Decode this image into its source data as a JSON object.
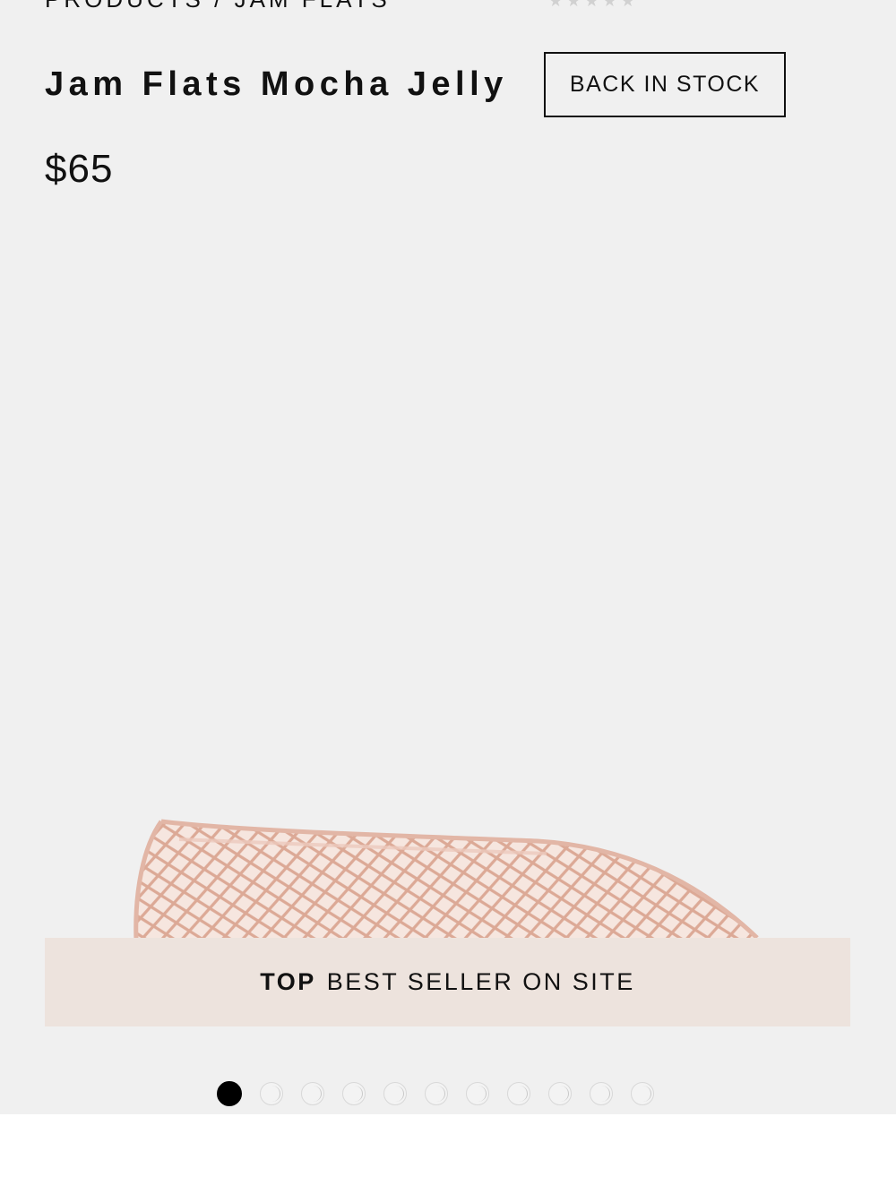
{
  "breadcrumb": "PRODUCTS / JAM FLATS",
  "product": {
    "title": "Jam Flats Mocha Jelly",
    "stock_badge": "BACK IN STOCK",
    "price": "$65"
  },
  "banner": {
    "strong": "TOP",
    "text": "BEST SELLER ON SITE"
  },
  "carousel": {
    "total_slides": 11,
    "active_index": 0
  },
  "colors": {
    "background": "#f0f0f0",
    "banner": "#ede3dd",
    "product_pink": "#e8bfb0",
    "text": "#111111"
  },
  "icons": {
    "dot_active": "filled-circle",
    "dot_inactive": "hollow-circle"
  }
}
